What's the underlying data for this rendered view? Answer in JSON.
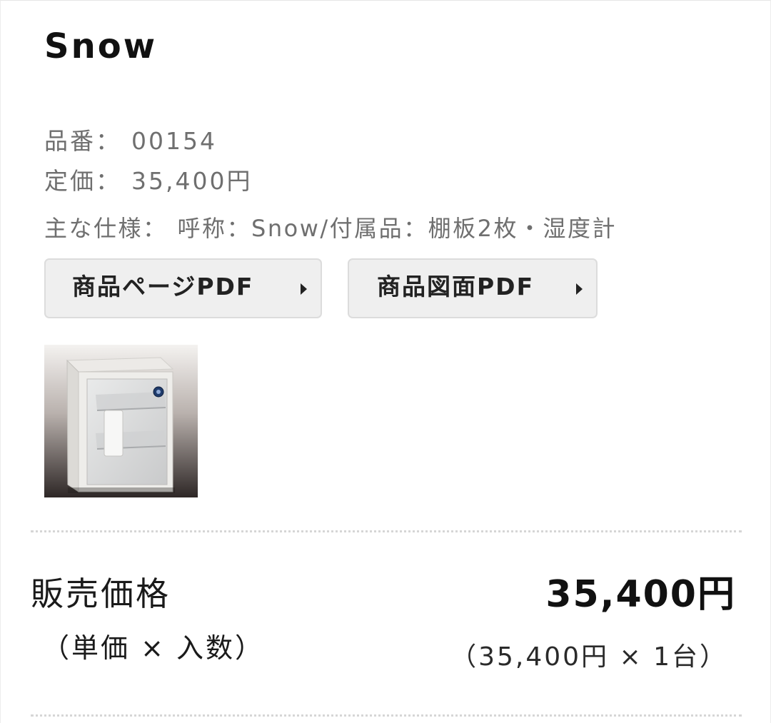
{
  "product": {
    "title": "Snow",
    "image_alt": "Snow"
  },
  "specs": [
    {
      "label": "品番：",
      "value": "00154"
    },
    {
      "label": "定価：",
      "value": "35,400円"
    },
    {
      "label": "主な仕様：",
      "value": "呼称：Snow/付属品：棚板2枚・湿度計"
    }
  ],
  "buttons": {
    "product_page_pdf": "商品ページPDF",
    "product_drawing_pdf": "商品図面PDF"
  },
  "pricing": {
    "label": "販売価格",
    "formula": "（単価 × 入数）",
    "total": "35,400円",
    "detail": "（35,400円 × 1台）"
  },
  "colors": {
    "button_bg": "#efefef",
    "button_border": "#dcdcdc",
    "spec_text": "#6f6f6f"
  }
}
